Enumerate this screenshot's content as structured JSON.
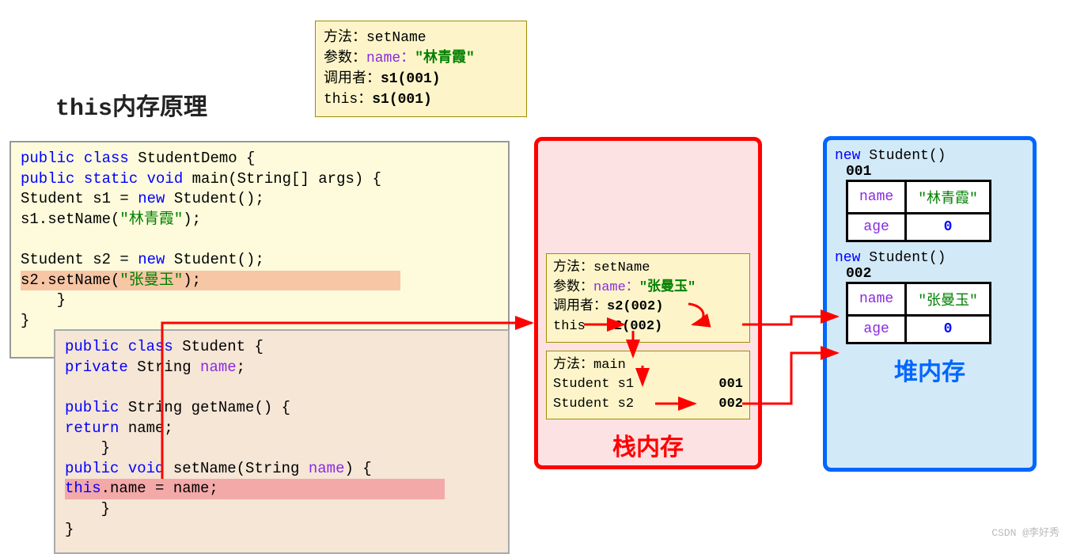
{
  "title": "this内存原理",
  "frame0": {
    "m_lbl": "方法：",
    "m_val": "setName",
    "p_lbl": "参数：",
    "p_name": "name：",
    "p_val": "\"林青霞\"",
    "c_lbl": "调用者：",
    "c_val": "s1(001)",
    "t_lbl": "this：",
    "t_val": "s1(001)"
  },
  "code1": {
    "l1a": "public class ",
    "l1b": "StudentDemo {",
    "l2a": "    public static void ",
    "l2b": "main(String[] args) {",
    "l3a": "        Student s1 = ",
    "l3b": "new ",
    "l3c": "Student();",
    "l4a": "        s1.setName(",
    "l4b": "\"林青霞\"",
    "l4c": ");",
    "blank": " ",
    "l5a": "        Student s2 = ",
    "l5b": "new ",
    "l5c": "Student();",
    "l6a": "        s2.setName(",
    "l6b": "\"张曼玉\"",
    "l6c": ");",
    "l7": "    }",
    "l8": "}"
  },
  "code2": {
    "l1a": "public class ",
    "l1b": "Student {",
    "l2a": "    private ",
    "l2b": "String ",
    "l2c": "name",
    "l2d": ";",
    "blank": " ",
    "l3a": "    public ",
    "l3b": "String getName() {",
    "l4a": "        return ",
    "l4b": "name;",
    "l5": "    }",
    "l6a": "    public void ",
    "l6b": "setName(String ",
    "l6c": "name",
    "l6d": ") {",
    "l7a": "        this",
    "l7b": ".name = name;",
    "l8": "    }",
    "l9": "}"
  },
  "stack": {
    "label": "栈内存",
    "f_set": {
      "m_lbl": "方法：",
      "m_val": "setName",
      "p_lbl": "参数：",
      "p_name": "name：",
      "p_val": "\"张曼玉\"",
      "c_lbl": "调用者：",
      "c_val": "s2(002)",
      "t_lbl": "this",
      "t_val": "s2(002)"
    },
    "f_main": {
      "m_lbl": "方法：",
      "m_val": "main",
      "r1_l": " Student s1",
      "r1_r": "001",
      "r2_l": " Student s2",
      "r2_r": "002"
    }
  },
  "heap": {
    "label": "堆内存",
    "obj1": {
      "hdr_a": "new",
      "hdr_b": " Student()",
      "addr": "001",
      "f1": "name",
      "v1": "\"林青霞\"",
      "f2": "age",
      "v2": "0"
    },
    "obj2": {
      "hdr_a": "new",
      "hdr_b": " Student()",
      "addr": "002",
      "f1": "name",
      "v1": "\"张曼玉\"",
      "f2": "age",
      "v2": "0"
    }
  },
  "watermark": "CSDN @李好秀"
}
